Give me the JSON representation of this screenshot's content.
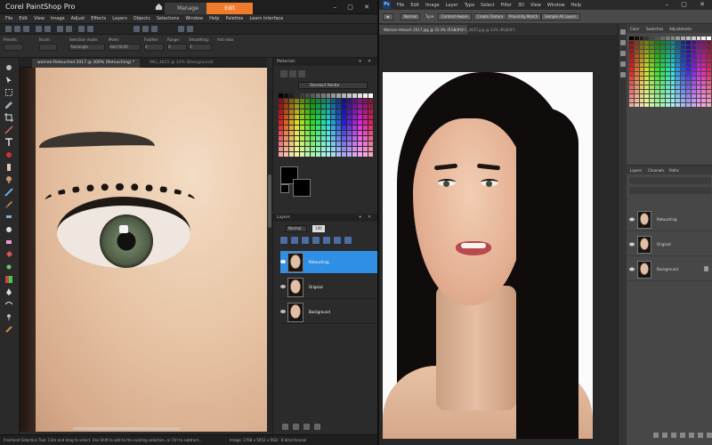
{
  "psp": {
    "title": "Corel PaintShop Pro",
    "tabs": {
      "manage": "Manage",
      "edit": "Edit"
    },
    "menu": [
      "File",
      "Edit",
      "View",
      "Image",
      "Adjust",
      "Effects",
      "Layers",
      "Objects",
      "Selections",
      "Window",
      "Help",
      "Palettes",
      "Learn Interface"
    ],
    "options": [
      {
        "label": "Presets:",
        "value": ""
      },
      {
        "label": "Brush:",
        "value": ""
      },
      {
        "label": "Selection mode:",
        "value": "Rectangle"
      },
      {
        "label": "Mode:",
        "value": "Add (Shift)"
      },
      {
        "label": "Feather:",
        "value": "0"
      },
      {
        "label": "Range:",
        "value": "0"
      },
      {
        "label": "Smoothing:",
        "value": "0"
      },
      {
        "label": "Anti-alias",
        "value": ""
      }
    ],
    "doc_tab": "woman-Retouched 2017 @ 300% (Retouching) *",
    "doc_tab2": "IMG_4835 @ 33% (Background)",
    "materials_panel": {
      "title": "Materials",
      "swatch_set": "Standard Palette"
    },
    "layers_panel": {
      "title": "Layers",
      "blend_mode": "Normal",
      "opacity": "100",
      "layers": [
        {
          "name": "Retouching",
          "active": true
        },
        {
          "name": "Original",
          "active": false
        },
        {
          "name": "Background",
          "active": false
        }
      ]
    },
    "status": {
      "text": "Freehand Selection Tool: Click and drag to select. Use Shift to add to the existing selection, or Ctrl to subtract...",
      "meta": "Image: 3768 x 5652 x RGB - 8 bits/channel"
    }
  },
  "ps": {
    "logo": "Ps",
    "menu": [
      "File",
      "Edit",
      "Image",
      "Layer",
      "Type",
      "Select",
      "Filter",
      "3D",
      "View",
      "Window",
      "Help"
    ],
    "options": {
      "pills": [
        "Normal",
        "Content-Aware",
        "Create Texture",
        "Proximity Match",
        "Sample All Layers"
      ],
      "type_label": "Type:"
    },
    "doc_tab": "Woman-retouch 2017.jpg @ 33.3% (RGB/8*)",
    "doc_tab2": "IMG_4835.jpg @ 33% (RGB/8*)",
    "swatch_tabs": [
      "Color",
      "Swatches",
      "Adjustments"
    ],
    "layer_tabs": [
      "Layers",
      "Channels",
      "Paths"
    ],
    "layers": [
      {
        "name": "Retouching",
        "locked": false
      },
      {
        "name": "Original",
        "locked": false
      },
      {
        "name": "Background",
        "locked": true
      }
    ]
  },
  "colors": {
    "psp_accent": "#f07b2b",
    "psp_selection": "#2f8fe5",
    "ps_logo": "#1a3d6e"
  }
}
